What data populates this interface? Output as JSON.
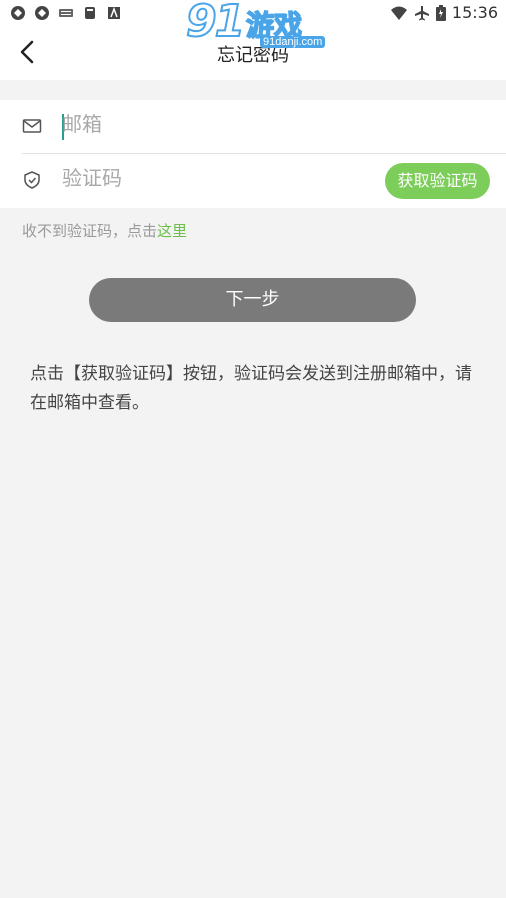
{
  "status_bar": {
    "time": "15:36",
    "left_icons": [
      "sync-icon",
      "sync-icon",
      "keyboard-icon",
      "sd-card-icon",
      "app-icon"
    ],
    "right_icons": [
      "wifi-icon",
      "airplane-icon",
      "battery-icon"
    ]
  },
  "watermark": {
    "brand_number": "91",
    "brand_text": "游戏",
    "url": "91danji.com"
  },
  "nav": {
    "title": "忘记密码",
    "back_icon": "chevron-left-icon"
  },
  "form": {
    "email_placeholder": "邮箱",
    "email_value": "",
    "code_placeholder": "验证码",
    "code_value": "",
    "get_code_button": "获取验证码",
    "email_icon": "mail-icon",
    "code_icon": "shield-icon"
  },
  "hint": {
    "prefix": "收不到验证码，点击",
    "link": "这里"
  },
  "next_button": "下一步",
  "description": {
    "line1": "点击【获取验证码】按钮，验证码会发送到注册邮箱中，请",
    "line2": "在邮箱中查看。"
  },
  "colors": {
    "accent_green": "#7ccd5a",
    "link_green": "#6cc04a",
    "button_gray": "#7a7a7a",
    "background": "#f3f3f3"
  }
}
